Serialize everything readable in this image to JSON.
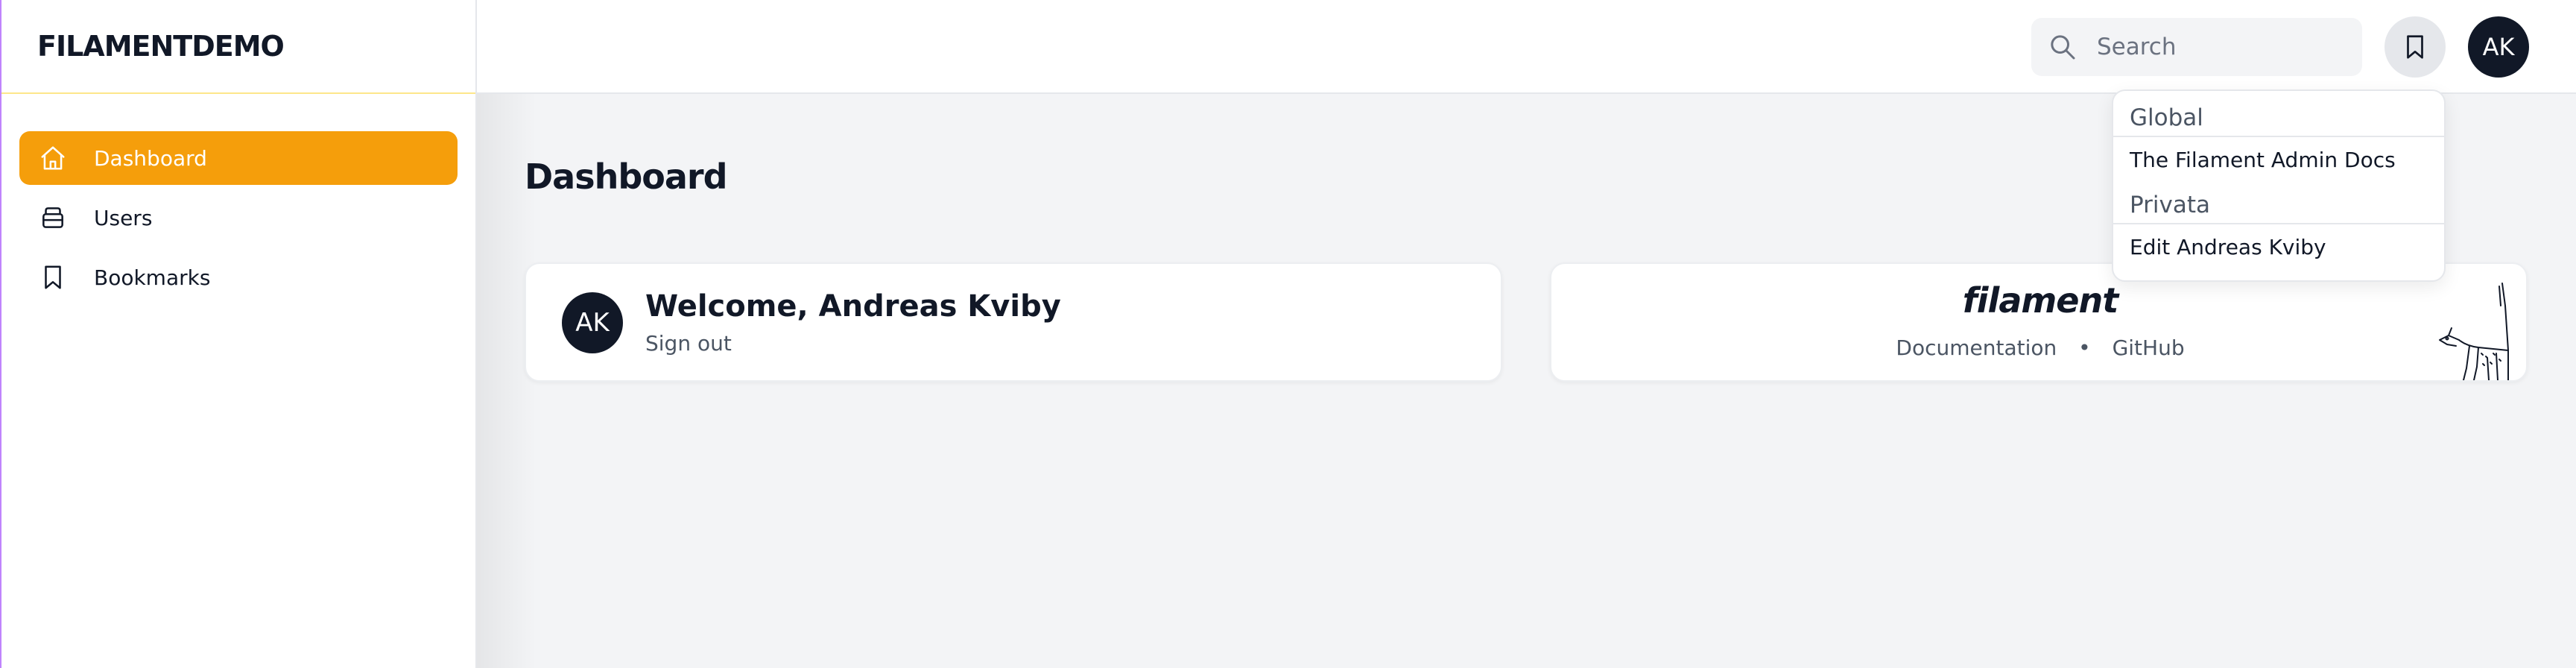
{
  "brand": "FILAMENTDEMO",
  "sidebar": {
    "items": [
      {
        "label": "Dashboard",
        "icon": "home-icon",
        "active": true
      },
      {
        "label": "Users",
        "icon": "database-icon",
        "active": false
      },
      {
        "label": "Bookmarks",
        "icon": "bookmark-icon",
        "active": false
      }
    ]
  },
  "topbar": {
    "search_placeholder": "Search",
    "avatar_initials": "AK"
  },
  "dropdown": {
    "groups": [
      {
        "title": "Global",
        "items": [
          "The Filament Admin Docs"
        ]
      },
      {
        "title": "Privata",
        "items": [
          "Edit Andreas Kviby"
        ]
      }
    ]
  },
  "page": {
    "title": "Dashboard"
  },
  "welcome_card": {
    "avatar_initials": "AK",
    "greeting": "Welcome, Andreas Kviby",
    "signout": "Sign out"
  },
  "filament_card": {
    "logo": "filament",
    "link_docs": "Documentation",
    "separator": "•",
    "link_github": "GitHub"
  },
  "colors": {
    "accent": "#f59e0b",
    "dark": "#111827",
    "background": "#f3f4f6"
  }
}
